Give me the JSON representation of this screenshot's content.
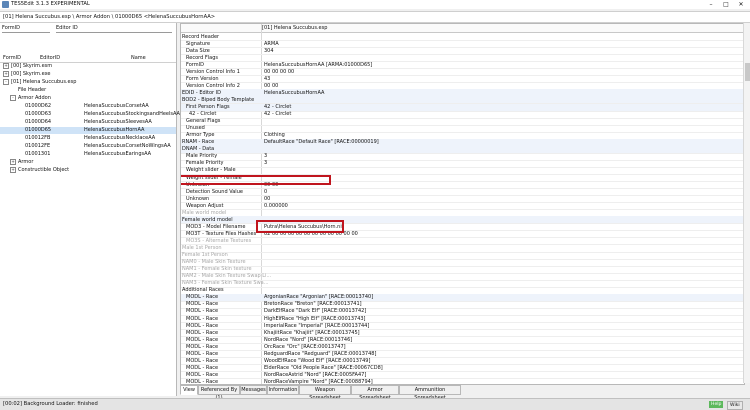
{
  "window": {
    "title": "TES5Edit 3.1.3 EXPERIMENTAL"
  },
  "pathbar": {
    "text": "[01] Helena Succubus.esp \\ Armor Addon \\ 01000D65 <HelenaSuccubusHornAA>"
  },
  "left": {
    "search": {
      "formid_label": "FormID",
      "editorid_label": "Editor ID"
    },
    "columns": [
      "FormID",
      "EditorID",
      "Name"
    ],
    "tree": [
      {
        "expander": "+",
        "formid": "[00] Skyrim.esm",
        "editorid": ""
      },
      {
        "expander": "+",
        "formid": "[00] Skyrim.exe",
        "editorid": ""
      },
      {
        "expander": "-",
        "formid": "[01] Helena Succubus.esp",
        "editorid": ""
      },
      {
        "expander": "",
        "formid": "File Header",
        "editorid": ""
      },
      {
        "expander": "-",
        "formid": "Armor Addon",
        "editorid": ""
      },
      {
        "expander": "",
        "formid": "01000D62",
        "editorid": "HelenaSuccubusCorsetAA"
      },
      {
        "expander": "",
        "formid": "01000D63",
        "editorid": "HelenaSuccubusStockingsandHeelsAA"
      },
      {
        "expander": "",
        "formid": "01000D64",
        "editorid": "HelenaSuccubusSleevesAA"
      },
      {
        "expander": "",
        "formid": "01000D65",
        "editorid": "HelenaSuccubusHornAA"
      },
      {
        "expander": "",
        "formid": "010012FB",
        "editorid": "HelenaSuccubusNecklaceAA"
      },
      {
        "expander": "",
        "formid": "010012FE",
        "editorid": "HelenaSuccubusCorsetNoWingsAA"
      },
      {
        "expander": "",
        "formid": "01001301",
        "editorid": "HelenaSuccubusEaringsAA"
      },
      {
        "expander": "+",
        "formid": "Armor",
        "editorid": ""
      },
      {
        "expander": "+",
        "formid": "Constructible Object",
        "editorid": ""
      }
    ]
  },
  "right": {
    "column_header": "[01] Helena Succubus.esp",
    "rows": [
      {
        "name": "Record Header",
        "value": ""
      },
      {
        "name": "Signature",
        "value": "ARMA"
      },
      {
        "name": "Data Size",
        "value": "304"
      },
      {
        "name": "Record Flags",
        "value": ""
      },
      {
        "name": "FormID",
        "value": "HelenaSuccubusHornAA [ARMA:01000D65]"
      },
      {
        "name": "Version Control Info 1",
        "value": "00 00 00 00"
      },
      {
        "name": "Form Version",
        "value": "43"
      },
      {
        "name": "Version Control Info 2",
        "value": "00 00"
      },
      {
        "name": "EDID - Editor ID",
        "value": "HelenaSuccubusHornAA"
      },
      {
        "name": "BOD2 - Biped Body Template",
        "value": ""
      },
      {
        "name": "First Person Flags",
        "value": "42 - Circlet"
      },
      {
        "name": "42 - Circlet",
        "value": "42 - Circlet"
      },
      {
        "name": "General Flags",
        "value": ""
      },
      {
        "name": "Unused",
        "value": ""
      },
      {
        "name": "Armor Type",
        "value": "Clothing"
      },
      {
        "name": "RNAM - Race",
        "value": "DefaultRace \"Default Race\" [RACE:00000019]"
      },
      {
        "name": "DNAM - Data",
        "value": ""
      },
      {
        "name": "Male Priority",
        "value": "3"
      },
      {
        "name": "Female Priority",
        "value": "3"
      },
      {
        "name": "Weight slider - Male",
        "value": ""
      },
      {
        "name": "Weight slider - Female",
        "value": ""
      },
      {
        "name": "Unknown",
        "value": "00 00"
      },
      {
        "name": "Detection Sound Value",
        "value": "0"
      },
      {
        "name": "Unknown",
        "value": "00"
      },
      {
        "name": "Weapon Adjust",
        "value": "0.000000"
      },
      {
        "name": "Male world model",
        "value": ""
      },
      {
        "name": "Female world model",
        "value": ""
      },
      {
        "name": "MOD3 - Model Filename",
        "value": "Putra\\Helena Succubus\\Horn.nif"
      },
      {
        "name": "MO3T - Texture Files Hashes",
        "value": "02 00 00 00 00 00 00 00 00 00 00 00"
      },
      {
        "name": "MO3S - Alternate Textures",
        "value": ""
      },
      {
        "name": "Male 1st Person",
        "value": ""
      },
      {
        "name": "Female 1st Person",
        "value": ""
      },
      {
        "name": "NAM0 - Male Skin Texture",
        "value": ""
      },
      {
        "name": "NAM1 - Female Skin texture",
        "value": ""
      },
      {
        "name": "NAM2 - Male Skin Texture Swap Li...",
        "value": ""
      },
      {
        "name": "NAM3 - Female Skin Texture Swa...",
        "value": ""
      },
      {
        "name": "Additional Races",
        "value": ""
      },
      {
        "name": "MODL - Race",
        "value": "ArgonianRace \"Argonian\" [RACE:00013740]"
      },
      {
        "name": "MODL - Race",
        "value": "BretonRace \"Breton\" [RACE:00013741]"
      },
      {
        "name": "MODL - Race",
        "value": "DarkElfRace \"Dark Elf\" [RACE:00013742]"
      },
      {
        "name": "MODL - Race",
        "value": "HighElfRace \"High Elf\" [RACE:00013743]"
      },
      {
        "name": "MODL - Race",
        "value": "ImperialRace \"Imperial\" [RACE:00013744]"
      },
      {
        "name": "MODL - Race",
        "value": "KhajiitRace \"Khajiit\" [RACE:00013745]"
      },
      {
        "name": "MODL - Race",
        "value": "NordRace \"Nord\" [RACE:00013746]"
      },
      {
        "name": "MODL - Race",
        "value": "OrcRace \"Orc\" [RACE:00013747]"
      },
      {
        "name": "MODL - Race",
        "value": "RedguardRace \"Redguard\" [RACE:00013748]"
      },
      {
        "name": "MODL - Race",
        "value": "WoodElfRace \"Wood Elf\" [RACE:00013749]"
      },
      {
        "name": "MODL - Race",
        "value": "ElderRace \"Old People Race\" [RACE:00067CD8]"
      },
      {
        "name": "MODL - Race",
        "value": "NordRaceAstrid \"Nord\" [RACE:0005FA47]"
      },
      {
        "name": "MODL - Race",
        "value": "NordRaceVampire \"Nord\" [RACE:00088794]"
      }
    ]
  },
  "tabs": [
    "View",
    "Referenced By (1)",
    "Messages",
    "Information",
    "Weapon Spreadsheet",
    "Armor Spreadsheet",
    "Ammunition Spreadsheet"
  ],
  "status": {
    "message": "[00:02] Background Loader: finished",
    "button1": "Help",
    "button2": "Wiki"
  },
  "colors": {
    "highlight": "#c0151e",
    "selection": "#cfe3f7"
  }
}
